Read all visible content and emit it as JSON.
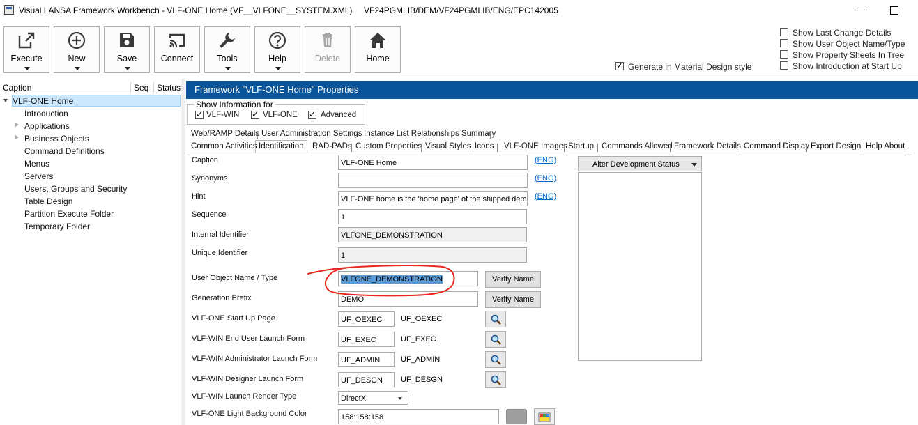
{
  "window": {
    "title": "Visual LANSA Framework Workbench - VLF-ONE Home (VF__VLFONE__SYSTEM.XML)     VF24PGMLIB/DEM/VF24PGMLIB/ENG/EPC142005"
  },
  "toolbar": {
    "buttons": [
      {
        "label": "Execute",
        "icon": "external-link-icon",
        "has_dropdown": true,
        "enabled": true
      },
      {
        "label": "New",
        "icon": "plus-circle-icon",
        "has_dropdown": true,
        "enabled": true
      },
      {
        "label": "Save",
        "icon": "floppy-disk-icon",
        "has_dropdown": true,
        "enabled": true
      },
      {
        "label": "Connect",
        "icon": "cast-icon",
        "has_dropdown": false,
        "enabled": true
      },
      {
        "label": "Tools",
        "icon": "wrench-icon",
        "has_dropdown": true,
        "enabled": true
      },
      {
        "label": "Help",
        "icon": "question-circle-icon",
        "has_dropdown": true,
        "enabled": true
      },
      {
        "label": "Delete",
        "icon": "trash-icon",
        "has_dropdown": false,
        "enabled": false
      },
      {
        "label": "Home",
        "icon": "home-icon",
        "has_dropdown": false,
        "enabled": true
      }
    ],
    "options": {
      "generate_material": {
        "label": "Generate in Material Design style",
        "checked": true
      },
      "show_last_change": {
        "label": "Show Last Change Details",
        "checked": false
      },
      "show_user_object": {
        "label": "Show User Object Name/Type",
        "checked": false
      },
      "show_property_sheets": {
        "label": "Show Property Sheets In Tree",
        "checked": false
      },
      "show_introduction": {
        "label": "Show Introduction at Start Up",
        "checked": false
      }
    }
  },
  "tree": {
    "columns": {
      "caption": "Caption",
      "seq": "Seq",
      "status": "Status"
    },
    "root": "VLF-ONE Home",
    "items": [
      "Introduction",
      "Applications",
      "Business Objects",
      "Command Definitions",
      "Menus",
      "Servers",
      "Users, Groups and Security",
      "Table Design",
      "Partition Execute Folder",
      "Temporary Folder"
    ]
  },
  "properties": {
    "header": "Framework \"VLF-ONE Home\" Properties",
    "show_info": {
      "legend": "Show Information for",
      "vlf_win": {
        "label": "VLF-WIN",
        "checked": true
      },
      "vlf_one": {
        "label": "VLF-ONE",
        "checked": true
      },
      "advanced": {
        "label": "Advanced",
        "checked": true
      }
    },
    "tabs_row1": [
      "Web/RAMP Details",
      "User Administration Settings",
      "Instance List Relationships Summary"
    ],
    "tabs_row2": [
      "Common Activities",
      "Identification",
      "RAD-PADs",
      "Custom Properties",
      "Visual Styles",
      "Icons",
      "VLF-ONE Images",
      "Startup",
      "Commands Allowed",
      "Framework Details",
      "Command Display",
      "Export Design",
      "Help About"
    ],
    "active_tab": "Identification",
    "eng_link": "(ENG)",
    "fields": {
      "caption": {
        "label": "Caption",
        "value": "VLF-ONE Home"
      },
      "synonyms": {
        "label": "Synonyms",
        "value": ""
      },
      "hint": {
        "label": "Hint",
        "value": "VLF-ONE home is the 'home page' of the shipped demon"
      },
      "sequence": {
        "label": "Sequence",
        "value": "1"
      },
      "internal_id": {
        "label": "Internal Identifier",
        "value": "VLFONE_DEMONSTRATION"
      },
      "unique_id": {
        "label": "Unique Identifier",
        "value": "1"
      },
      "user_object": {
        "label": "User Object Name / Type",
        "value": "VLFONE_DEMONSTRATION"
      },
      "gen_prefix": {
        "label": "Generation Prefix",
        "value": "DEMO"
      },
      "startup_page": {
        "label": "VLF-ONE Start Up Page",
        "value": "UF_OEXEC",
        "display": "UF_OEXEC"
      },
      "win_user_form": {
        "label": "VLF-WIN End User Launch Form",
        "value": "UF_EXEC",
        "display": "UF_EXEC"
      },
      "win_admin_form": {
        "label": "VLF-WIN Administrator Launch Form",
        "value": "UF_ADMIN",
        "display": "UF_ADMIN"
      },
      "win_designer_form": {
        "label": "VLF-WIN Designer Launch Form",
        "value": "UF_DESGN",
        "display": "UF_DESGN"
      },
      "render_type": {
        "label": "VLF-WIN Launch Render Type",
        "value": "DirectX"
      },
      "light_bg": {
        "label": "VLF-ONE Light Background Color",
        "value": "158:158:158",
        "swatch": "#9e9e9e"
      }
    },
    "verify_button": "Verify Name",
    "alter_status": "Alter Development Status"
  },
  "colors": {
    "header_blue": "#0a549a",
    "selection": "#cce8ff",
    "annotation_red": "#e8261f",
    "link_blue": "#0066cc"
  }
}
